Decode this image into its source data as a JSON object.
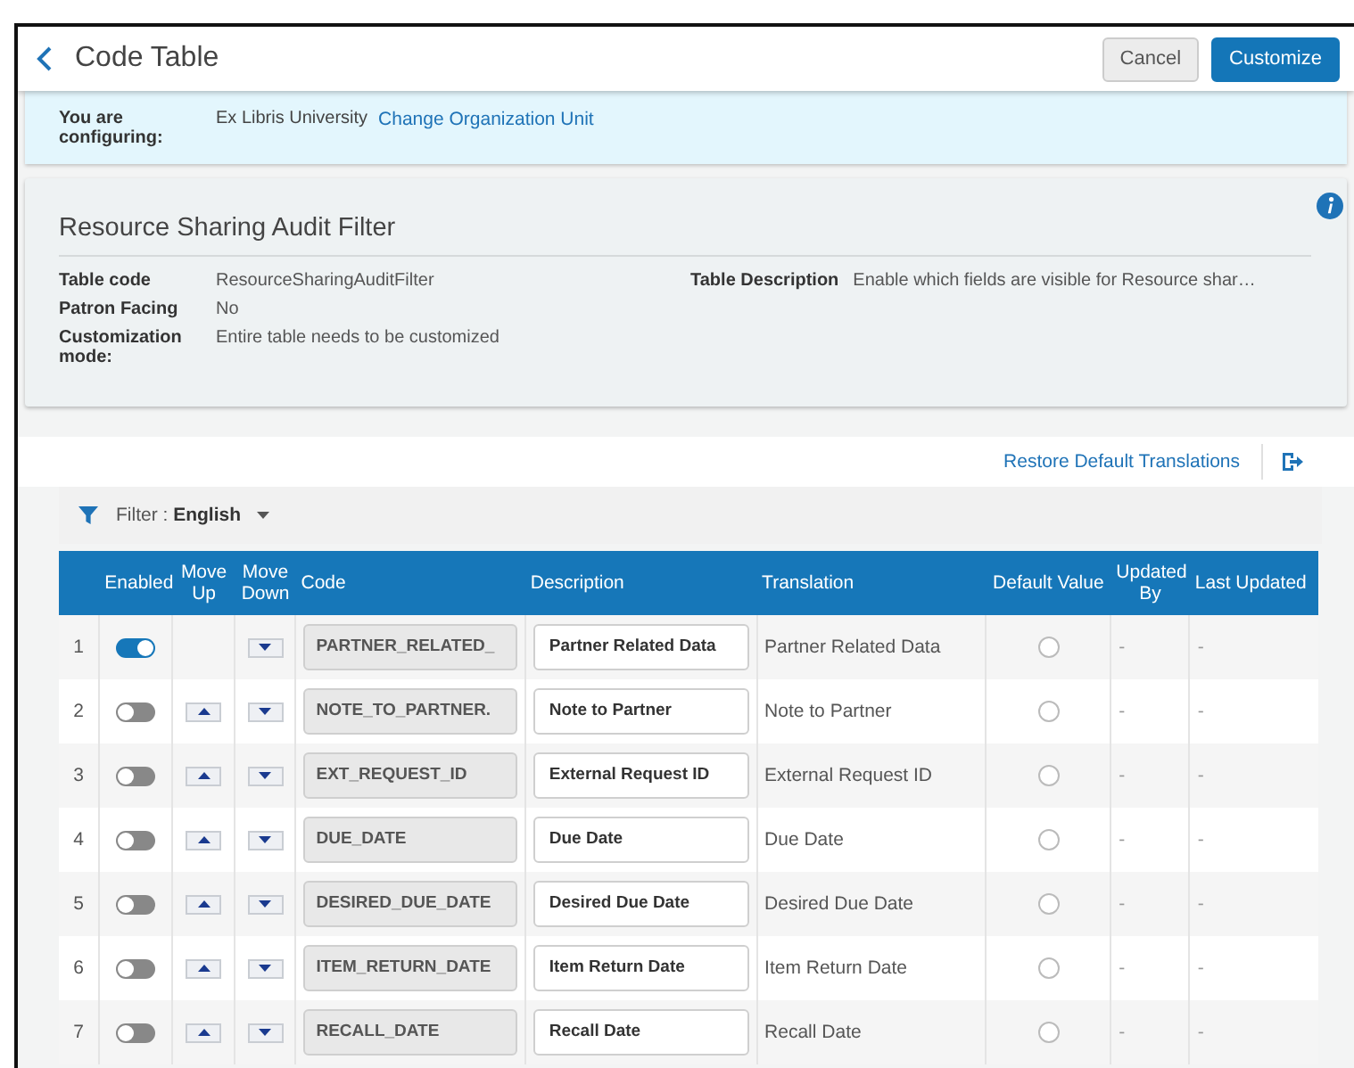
{
  "header": {
    "title": "Code Table",
    "buttons": [
      {
        "label": "Cancel",
        "kind": "secondary"
      },
      {
        "label": "Customize",
        "kind": "primary"
      }
    ]
  },
  "configuring": {
    "label": "You are configuring:",
    "value": "Ex Libris University",
    "link": "Change Organization Unit"
  },
  "table_info": {
    "title": "Resource Sharing Audit Filter",
    "fields": [
      {
        "label": "Table code",
        "value": "ResourceSharingAuditFilter"
      },
      {
        "label": "Patron Facing",
        "value": "No"
      },
      {
        "label": "Customization mode:",
        "value": "Entire table needs to be customized"
      }
    ],
    "description": {
      "label": "Table Description",
      "value": "Enable which fields are visible for Resource shar…"
    }
  },
  "actions": {
    "restore_link": "Restore Default Translations"
  },
  "filter": {
    "label": "Filter :",
    "value": "English"
  },
  "table": {
    "columns": [
      "Enabled",
      "Move Up",
      "Move Down",
      "Code",
      "Description",
      "Translation",
      "Default Value",
      "Updated By",
      "Last Updated"
    ],
    "rows": [
      {
        "number": "1",
        "enabled": true,
        "move_up": false,
        "move_down": true,
        "code": "PARTNER_RELATED_",
        "description": "Partner Related Data",
        "translation": "Partner Related Data",
        "default": false,
        "updated_by": "-",
        "last_updated": "-"
      },
      {
        "number": "2",
        "enabled": false,
        "move_up": true,
        "move_down": true,
        "code": "NOTE_TO_PARTNER.",
        "description": "Note to Partner",
        "translation": "Note to Partner",
        "default": false,
        "updated_by": "-",
        "last_updated": "-"
      },
      {
        "number": "3",
        "enabled": false,
        "move_up": true,
        "move_down": true,
        "code": "EXT_REQUEST_ID",
        "description": "External Request ID",
        "translation": "External Request ID",
        "default": false,
        "updated_by": "-",
        "last_updated": "-"
      },
      {
        "number": "4",
        "enabled": false,
        "move_up": true,
        "move_down": true,
        "code": "DUE_DATE",
        "description": "Due Date",
        "translation": "Due Date",
        "default": false,
        "updated_by": "-",
        "last_updated": "-"
      },
      {
        "number": "5",
        "enabled": false,
        "move_up": true,
        "move_down": true,
        "code": "DESIRED_DUE_DATE",
        "description": "Desired Due Date",
        "translation": "Desired Due Date",
        "default": false,
        "updated_by": "-",
        "last_updated": "-"
      },
      {
        "number": "6",
        "enabled": false,
        "move_up": true,
        "move_down": true,
        "code": "ITEM_RETURN_DATE",
        "description": "Item Return Date",
        "translation": "Item Return Date",
        "default": false,
        "updated_by": "-",
        "last_updated": "-"
      },
      {
        "number": "7",
        "enabled": false,
        "move_up": true,
        "move_down": true,
        "code": "RECALL_DATE",
        "description": "Recall Date",
        "translation": "Recall Date",
        "default": false,
        "updated_by": "-",
        "last_updated": "-"
      }
    ]
  }
}
